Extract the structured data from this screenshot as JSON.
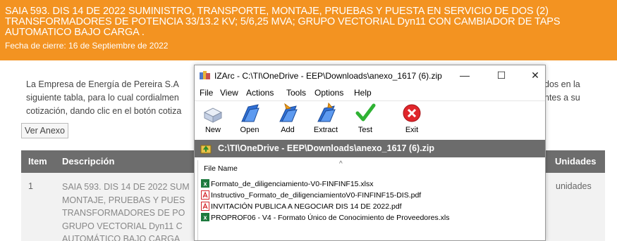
{
  "banner": {
    "title": "SAIA 593. DIS 14 DE 2022 SUMINISTRO, TRANSPORTE, MONTAJE, PRUEBAS Y PUESTA EN SERVICIO DE DOS (2) TRANSFORMADORES DE POTENCIA 33/13.2 KV; 5/6,25 MVA; GRUPO VECTORIAL Dyn11 CON CAMBIADOR DE TAPS AUTOMATICO BAJO CARGA .",
    "closing_date": "Fecha de cierre: 16 de Septiembre de 2022"
  },
  "intro": {
    "left_lines": [
      "La Empresa de Energía de Pereira S.A",
      "siguiente tabla, para lo cual cordialmen",
      "cotización, dando clic en el botón cotiza"
    ],
    "right_lines": [
      "dos en la",
      "ntes a su"
    ]
  },
  "ver_anexo_label": "Ver Anexo",
  "table": {
    "headers": {
      "item": "Item",
      "description": "Descripción",
      "units": "Unidades"
    },
    "row": {
      "item": "1",
      "description_lines": [
        "SAIA 593. DIS 14 DE 2022 SUM",
        "MONTAJE, PRUEBAS Y PUES",
        "TRANSFORMADORES DE PO",
        "GRUPO VECTORIAL Dyn11 C",
        "AUTOMÁTICO BAJO CARGA"
      ],
      "units": "unidades"
    }
  },
  "window": {
    "title": "IZArc - C:\\TI\\OneDrive - EEP\\Downloads\\anexo_1617 (6).zip",
    "controls": {
      "minimize": "—",
      "maximize": "☐",
      "close": "✕"
    },
    "menu": [
      "File",
      "View",
      "Actions",
      "Tools",
      "Options",
      "Help"
    ],
    "toolbar": [
      {
        "label": "New",
        "icon": "new-archive-icon"
      },
      {
        "label": "Open",
        "icon": "open-folder-icon"
      },
      {
        "label": "Add",
        "icon": "add-folder-icon"
      },
      {
        "label": "Extract",
        "icon": "extract-folder-icon"
      },
      {
        "label": "Test",
        "icon": "checkmark-icon"
      },
      {
        "label": "Exit",
        "icon": "exit-icon"
      }
    ],
    "path": "C:\\TI\\OneDrive - EEP\\Downloads\\anexo_1617 (6).zip",
    "column_header": "File Name",
    "files": [
      {
        "name": "Formato_de_diligenciamiento-V0-FINFINF15.xlsx",
        "type": "excel"
      },
      {
        "name": "Instructivo_Formato_de_diligenciamientoV0-FINFINF15-DIS.pdf",
        "type": "pdf"
      },
      {
        "name": "INVITACIÓN PUBLICA A NEGOCIAR DIS 14 DE 2022.pdf",
        "type": "pdf"
      },
      {
        "name": "PROPROF06 - V4 - Formato Único de Conocimiento de Proveedores.xls",
        "type": "excel"
      }
    ]
  },
  "colors": {
    "banner": "#f39321",
    "table_header": "#6d6d6d",
    "path_bar": "#6c6c6c",
    "exit_red": "#e0262b",
    "test_green": "#2fb233"
  }
}
